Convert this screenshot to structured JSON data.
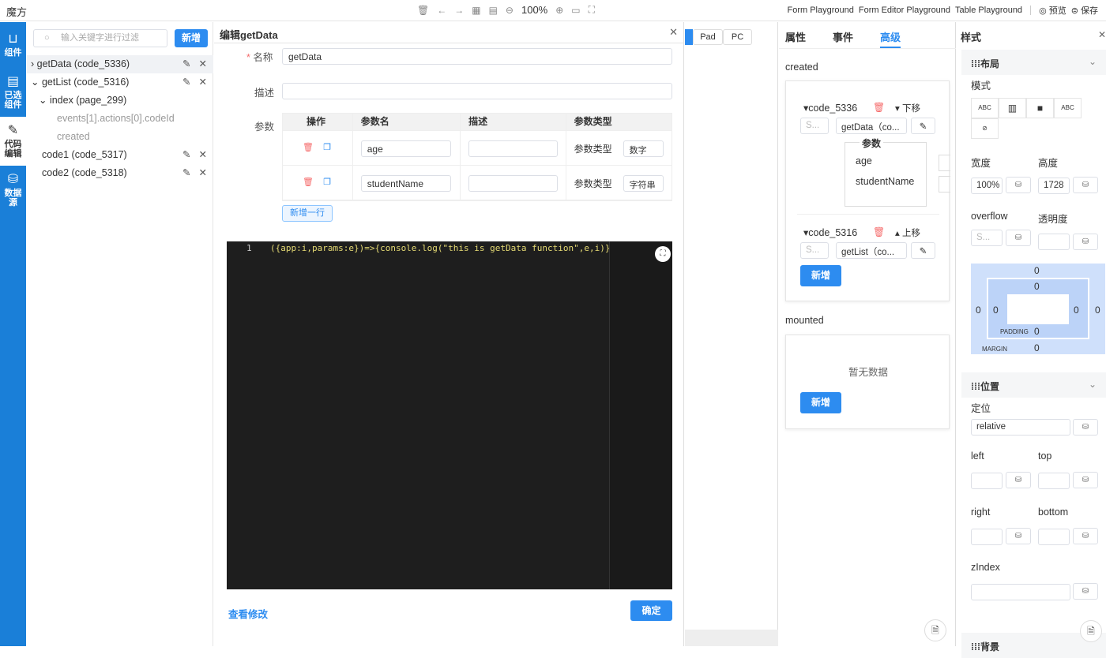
{
  "app": {
    "title": "魔方"
  },
  "toolbar": {
    "zoom": "100%",
    "links": [
      "Form Playground",
      "Form Editor Playground",
      "Table Playground"
    ],
    "preview": "预览",
    "save": "保存"
  },
  "iconbar": [
    {
      "label": "组件",
      "icon": "bag-icon"
    },
    {
      "label": "已选组件",
      "icon": "clipboard-icon"
    },
    {
      "label": "代码编辑",
      "icon": "pencil-icon"
    },
    {
      "label": "数据源",
      "icon": "database-icon"
    }
  ],
  "tree": {
    "placeholder": "输入关键字进行过滤",
    "add": "新增",
    "nodes": [
      {
        "label": "getData (code_5336)"
      },
      {
        "label": "getList (code_5316)"
      },
      {
        "label": "index (page_299)"
      },
      {
        "label": "events[1].actions[0].codeId"
      },
      {
        "label": "created"
      },
      {
        "label": "code1 (code_5317)"
      },
      {
        "label": "code2 (code_5318)"
      }
    ]
  },
  "modal": {
    "title": "编辑getData",
    "name_label": "名称",
    "name_value": "getData",
    "desc_label": "描述",
    "desc_value": "",
    "params_label": "参数",
    "columns": [
      "操作",
      "参数名",
      "描述",
      "参数类型"
    ],
    "rows": [
      {
        "name": "age",
        "desc": "",
        "type_label": "参数类型",
        "type": "数字"
      },
      {
        "name": "studentName",
        "desc": "",
        "type_label": "参数类型",
        "type": "字符串"
      }
    ],
    "add_row": "新增一行",
    "line_no": "1",
    "code": "({app:i,params:e})=>{console.log(\"this is getData function\",e,i)}",
    "view_changes": "查看修改",
    "confirm": "确定"
  },
  "canvas": {
    "devices": [
      "Pad",
      "PC"
    ]
  },
  "props": {
    "tabs": [
      "属性",
      "事件",
      "高级"
    ],
    "created_label": "created",
    "actions": [
      {
        "code": "code_5336",
        "move": "下移",
        "placeholder": "S...",
        "func": "getData（co...",
        "params_title": "参数",
        "params": [
          "age",
          "studentName"
        ]
      },
      {
        "code": "code_5316",
        "move": "上移",
        "placeholder": "S...",
        "func": "getList（co..."
      }
    ],
    "add": "新增",
    "mounted_label": "mounted",
    "empty": "暂无数据"
  },
  "style": {
    "title": "样式",
    "layout": "布局",
    "mode": "模式",
    "mode_buttons": [
      "ABC",
      "▥",
      "■",
      "ABC"
    ],
    "width_label": "宽度",
    "width": "100%",
    "height_label": "高度",
    "height": "1728",
    "overflow_label": "overflow",
    "overflow_placeholder": "S...",
    "opacity_label": "透明度",
    "box": {
      "margin": "MARGIN",
      "padding": "PADDING",
      "mt": "0",
      "mr": "0",
      "mb": "0",
      "ml": "0",
      "pt": "0",
      "pr": "0",
      "pb": "0",
      "pl": "0"
    },
    "position": "位置",
    "pos_label": "定位",
    "pos_value": "relative",
    "left": "left",
    "top": "top",
    "right": "right",
    "bottom": "bottom",
    "zindex": "zIndex",
    "background": "背景"
  }
}
